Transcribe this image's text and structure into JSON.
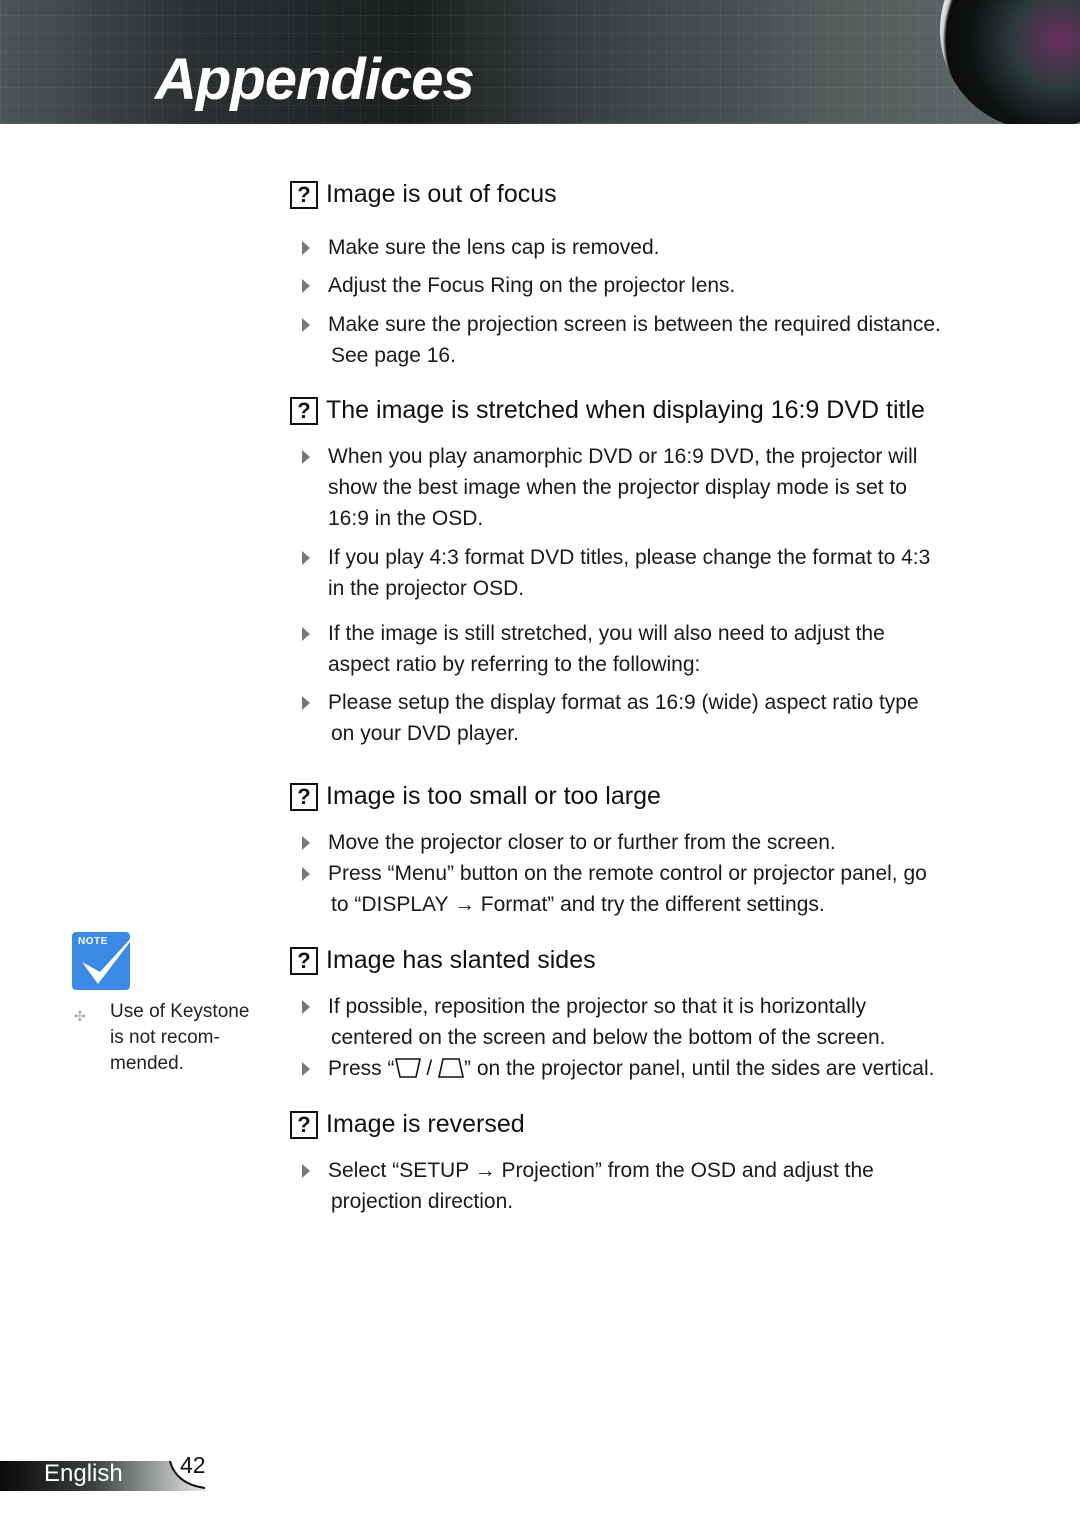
{
  "header": {
    "title": "Appendices"
  },
  "sections": [
    {
      "title": "Image is out of focus",
      "bullets": [
        [
          "Make sure the lens cap is removed."
        ],
        [
          "Adjust the Focus Ring on the projector lens."
        ],
        [
          "Make sure the projection screen is between the required distance.",
          "See page 16."
        ]
      ]
    },
    {
      "title": "The image is stretched when displaying 16:9 DVD title",
      "bullets": [
        [
          "When you play anamorphic DVD or 16:9 DVD, the projector will",
          "show the best image when the projector display mode is set to",
          "16:9 in the OSD."
        ],
        [
          "If you play 4:3 format DVD titles, please change the format to 4:3",
          "in the projector OSD."
        ],
        [
          "If the image is still stretched, you will also need to adjust the",
          "aspect ratio by referring to the following:"
        ],
        [
          "Please setup the display format as 16:9 (wide) aspect ratio type",
          "on your DVD player."
        ]
      ]
    },
    {
      "title": "Image is too small or too large",
      "bullets": [
        [
          "Move the projector closer to or further from the screen."
        ],
        [
          "Press “Menu” button on the remote control or projector panel, go",
          "to “DISPLAY → Format” and try the different settings."
        ]
      ]
    },
    {
      "title": "Image has slanted sides",
      "bullets": [
        [
          "If possible, reposition the projector so that it is horizontally",
          "centered on the screen and below the bottom of the screen."
        ]
      ],
      "keystone_bullet": {
        "prefix": "Press “",
        "separator": " / ",
        "suffix": "” on the projector panel, until the sides are vertical."
      }
    },
    {
      "title": "Image is reversed",
      "bullets": [
        [
          "Select “SETUP → Projection” from the OSD and adjust the",
          "projection direction."
        ]
      ]
    }
  ],
  "note": {
    "label": "NOTE",
    "text": [
      "Use of Keystone",
      "is not recom-",
      "mended."
    ]
  },
  "footer": {
    "language": "English",
    "page_number": "42"
  }
}
